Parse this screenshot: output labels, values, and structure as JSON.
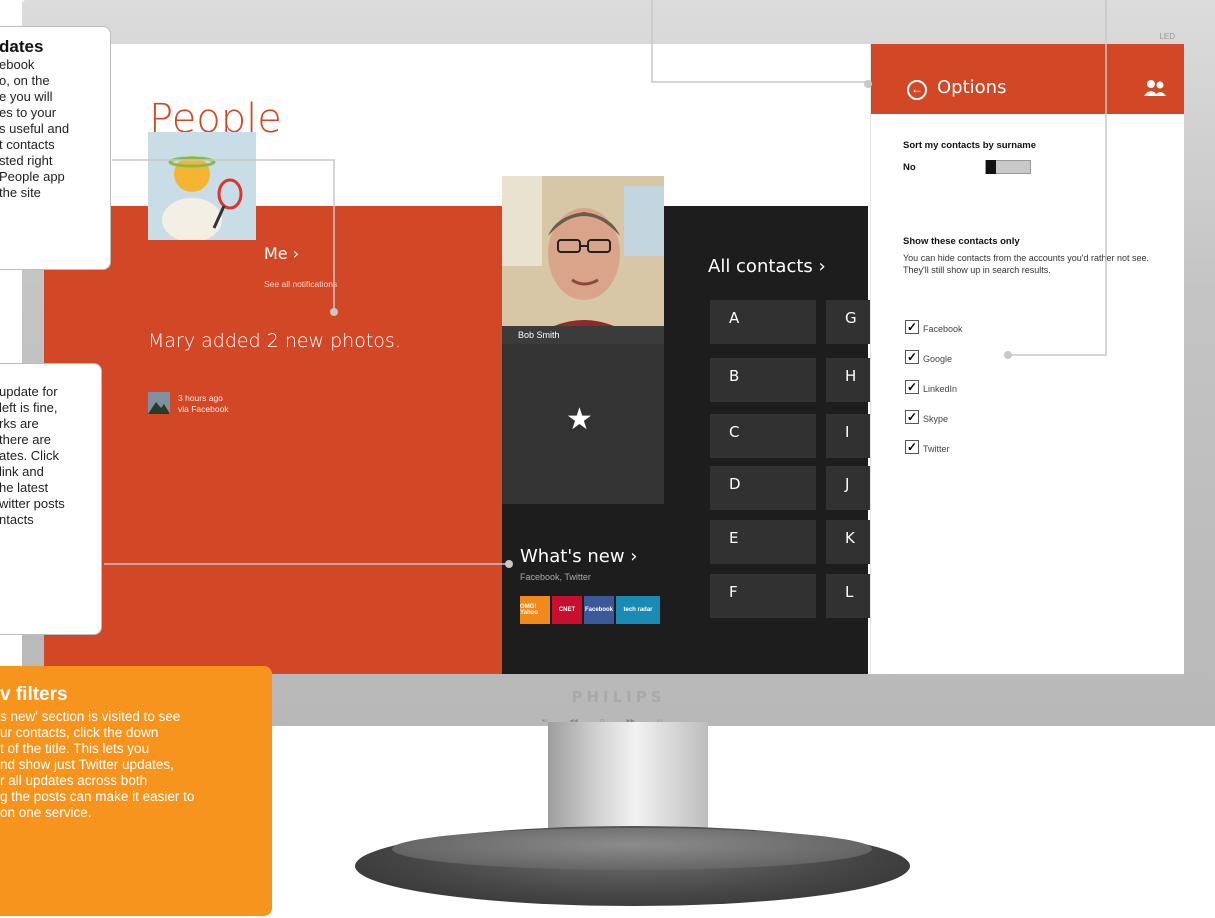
{
  "app": {
    "title": "People"
  },
  "me": {
    "label": "Me ›",
    "sublabel": "See all notifications"
  },
  "feed": {
    "text": "Mary  added 2 new photos.",
    "time": "3 hours ago",
    "source": "via Facebook"
  },
  "favorite": {
    "name": "Bob Smith",
    "star": "★"
  },
  "whats_new": {
    "label": "What's new ›",
    "sub": "Facebook,  Twitter",
    "logos": [
      "OMG! Yahoo",
      "CNET",
      "Facebook",
      "tech radar"
    ]
  },
  "all_contacts": {
    "label": "All contacts ›",
    "left_letters": [
      "A",
      "B",
      "C",
      "D",
      "E",
      "F"
    ],
    "right_letters": [
      "G",
      "H",
      "I",
      "J",
      "K",
      "L"
    ]
  },
  "options": {
    "title": "Options",
    "sort_label": "Sort my contacts by surname",
    "sort_value": "No",
    "show_label": "Show these contacts only",
    "show_desc": "You can hide contacts from the accounts you'd rather not see. They'll still show up in search results.",
    "accounts": [
      "Facebook",
      "Google",
      "LinkedIn",
      "Skype",
      "Twitter"
    ]
  },
  "monitor": {
    "brand": "PHILIPS",
    "led": "LED"
  },
  "callouts": {
    "updates": {
      "title": "dates",
      "lines": [
        "ebook",
        "o, on the",
        "e you will",
        "es to your",
        "s useful and",
        "t contacts",
        "sted right",
        "People app",
        " the site"
      ]
    },
    "middle": {
      "lines": [
        "update for",
        "left is fine,",
        "rks are",
        "there are",
        "ates. Click",
        "link and",
        "he latest",
        "witter posts",
        "ntacts"
      ]
    },
    "filters": {
      "title": "v filters",
      "lines": [
        "s new' section is visited to see",
        "ur contacts, click the down",
        "t of the title. This lets you",
        "nd show just Twitter updates,",
        "r all updates across both",
        "g the posts can make it easier to",
        " on one service."
      ]
    }
  },
  "colors": {
    "accent": "#d24726",
    "dark": "#1d1d1d",
    "callout_orange": "#f7941d"
  }
}
